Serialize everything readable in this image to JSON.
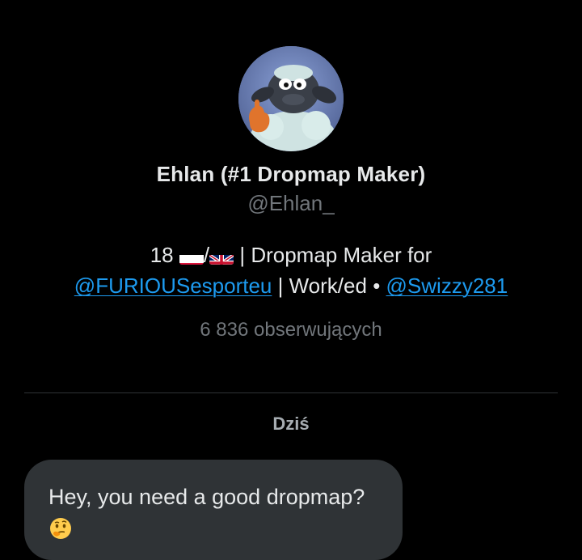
{
  "profile": {
    "avatar_alt": "avatar",
    "display_name": "Ehlan (#1 Dropmap Maker)",
    "handle": "@Ehlan_",
    "bio": {
      "age": "18",
      "slash": "/",
      "separator1": "|",
      "role": "Dropmap Maker for",
      "mention1": "@FURIOUSesporteu",
      "separator2": "|",
      "work": "Work/ed",
      "dot": "•",
      "mention2": "@Swizzy281"
    },
    "followers": "6 836 obserwujących"
  },
  "conversation": {
    "day_label": "Dziś",
    "messages": [
      {
        "text": "Hey, you need a good dropmap?",
        "emoji": "thinking-face-emoji"
      }
    ]
  },
  "colors": {
    "background": "#000000",
    "text": "#e7e9ea",
    "muted": "#71767b",
    "link": "#1d9bf0",
    "bubble": "#2f3336"
  }
}
